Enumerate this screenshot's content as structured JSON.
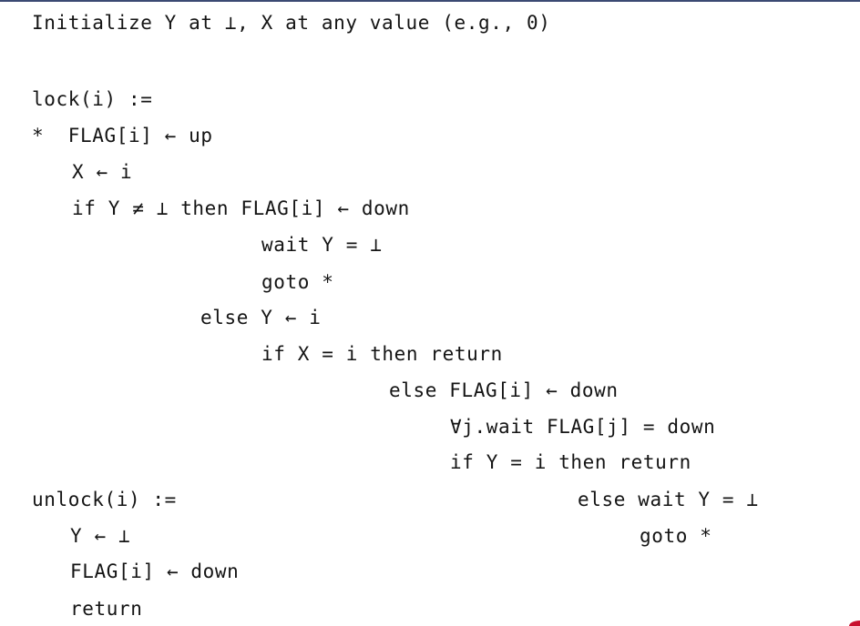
{
  "code": {
    "init": "Initialize Y at ⊥, X at any value (e.g., 0)",
    "lock": [
      "lock(i) :=",
      "*  FLAG[i] ← up",
      "X ← i",
      "if Y ≠ ⊥ then FLAG[i] ← down",
      "wait Y = ⊥",
      "goto *",
      "else Y ← i",
      "if X = i then return",
      "else FLAG[i] ← down",
      "∀j.wait FLAG[j] = down",
      "if Y = i then return",
      "else wait Y = ⊥",
      "goto *"
    ],
    "unlock": [
      "unlock(i) :=",
      "Y ← ⊥",
      "FLAG[i] ← down",
      "return"
    ]
  }
}
